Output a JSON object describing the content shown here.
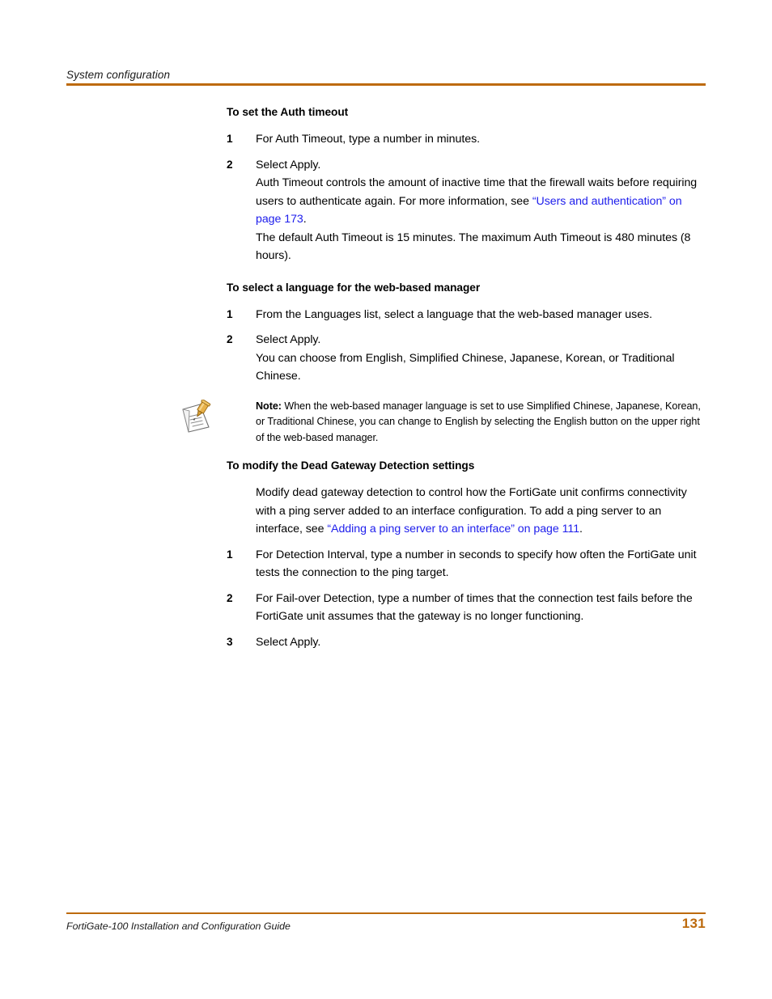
{
  "document": {
    "running_header": "System configuration",
    "footer_text": "FortiGate-100 Installation and Configuration Guide",
    "page_number": "131",
    "accent_color": "#bd6a0d",
    "link_color": "#1d1dec"
  },
  "sections": [
    {
      "heading": "To set the Auth timeout",
      "steps": [
        {
          "num": "1",
          "text": "For Auth Timeout, type a number in minutes."
        },
        {
          "num": "2",
          "text": "Select Apply."
        }
      ],
      "paragraph_1_part_1": "Auth Timeout controls the amount of inactive time that the firewall waits before requiring users to authenticate again. For more information, see ",
      "paragraph_1_link": "“Users and authentication” on page 173",
      "paragraph_1_part_2": ".",
      "paragraph_2": "The default Auth Timeout is 15 minutes. The maximum Auth Timeout is 480 minutes (8 hours)."
    },
    {
      "heading": "To select a language for the web-based manager",
      "steps": [
        {
          "num": "1",
          "text": "From the Languages list, select a language that the web-based manager uses."
        },
        {
          "num": "2",
          "text": "Select Apply."
        }
      ],
      "paragraph_1": "You can choose from English, Simplified Chinese, Japanese, Korean, or Traditional Chinese."
    },
    {
      "heading": "To modify the Dead Gateway Detection settings",
      "intro_part_1": "Modify dead gateway detection to control how the FortiGate unit confirms connectivity with a ping server added to an interface configuration. To add a ping server to an interface, see ",
      "intro_link": "“Adding a ping server to an interface” on page 111",
      "intro_part_2": ".",
      "steps": [
        {
          "num": "1",
          "text": "For Detection Interval, type a number in seconds to specify how often the FortiGate unit tests the connection to the ping target."
        },
        {
          "num": "2",
          "text": "For Fail-over Detection, type a number of times that the connection test fails before the FortiGate unit assumes that the gateway is no longer functioning."
        },
        {
          "num": "3",
          "text": "Select Apply."
        }
      ]
    }
  ],
  "note": {
    "icon": "note-pencil-paper-icon",
    "label": "Note:",
    "text": " When the web-based manager language is set to use Simplified Chinese, Japanese, Korean, or Traditional Chinese, you can change to English by selecting the English button on the upper right of the web-based manager."
  }
}
